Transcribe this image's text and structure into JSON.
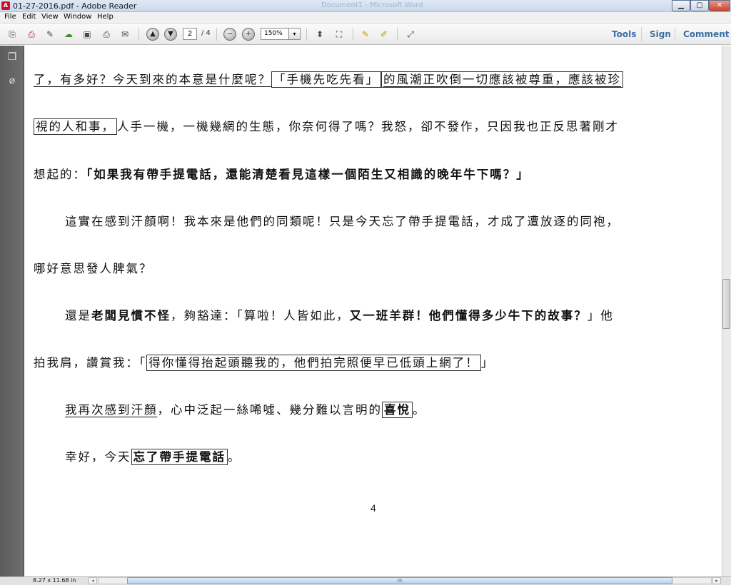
{
  "window": {
    "title": "01-27-2016.pdf - Adobe Reader",
    "background_title": "Document1 - Microsoft Word",
    "app_icon_glyph": "A",
    "minimize_glyph": "▁",
    "maximize_glyph": "▢",
    "close_glyph": "✕"
  },
  "menu": [
    "File",
    "Edit",
    "View",
    "Window",
    "Help"
  ],
  "toolbar": {
    "current_page": "2",
    "page_total": "/ 4",
    "zoom": "150%",
    "zoom_dropdown_glyph": "▾",
    "right_links": [
      "Tools",
      "Sign",
      "Comment"
    ],
    "icon_glyphs": {
      "create": "⎘",
      "pdf": "⎙",
      "edit": "✎",
      "upload": "☁",
      "save": "▣",
      "print": "⎙",
      "email": "✉",
      "prev_page": "▲",
      "next_page": "▼",
      "zoom_out": "−",
      "zoom_in": "+",
      "fit_page": "⬍",
      "fit_width": "⛶",
      "comment": "✎",
      "highlight": "✐",
      "fullscreen": "⤢"
    }
  },
  "nav_pane": {
    "icons": [
      "page-thumbnails-icon",
      "attachments-icon"
    ],
    "icon_glyphs": [
      "❐",
      "⌀"
    ]
  },
  "document": {
    "lines": [
      {
        "segments": [
          {
            "text": "了，有多好？今天到來的本意是什麼呢？",
            "style": "ul"
          },
          {
            "text": "「手機先吃先看」",
            "style": "box"
          },
          {
            "text": "的風潮正吹倒一切應該被尊重，應該被珍",
            "style": "ul-box"
          }
        ]
      },
      {
        "segments": [
          {
            "text": "視的人和事，",
            "style": "box"
          },
          {
            "text": "人手一機，一機幾網的生態，你奈何得了嗎？我怒，卻不發作，只因我也正反思著剛才",
            "style": ""
          }
        ]
      },
      {
        "segments": [
          {
            "text": "想起的：",
            "style": ""
          },
          {
            "text": "「如果我有帶手提電話，還能清楚看見這樣一個陌生又相識的晚年牛下嗎？」",
            "style": "bold"
          }
        ]
      },
      {
        "segments": [
          {
            "text": "這實在感到汗顏啊！我本來是他們的同類呢！只是今天忘了帶手提電話，才成了遭放逐的同袍，",
            "style": ""
          }
        ]
      },
      {
        "segments": [
          {
            "text": "哪好意思發人脾氣？",
            "style": ""
          }
        ]
      },
      {
        "segments": [
          {
            "text": "還是",
            "style": ""
          },
          {
            "text": "老闆見慣不怪",
            "style": "bold"
          },
          {
            "text": "，夠豁達：「算啦！人皆如此，",
            "style": ""
          },
          {
            "text": "又一班羊群！他們懂得多少牛下的故事？",
            "style": "bold"
          },
          {
            "text": "」他",
            "style": ""
          }
        ]
      },
      {
        "segments": [
          {
            "text": "拍我肩，讚賞我：「",
            "style": ""
          },
          {
            "text": "得你懂得抬起頭聽我的，他們拍完照便早已低頭上網了！",
            "style": "box"
          },
          {
            "text": "」",
            "style": ""
          }
        ]
      },
      {
        "segments": [
          {
            "text": "我再次感到汗顏",
            "style": "ul"
          },
          {
            "text": "，心中泛起一絲唏噓、幾分難以言明的",
            "style": ""
          },
          {
            "text": "喜悅",
            "style": "bold-box"
          },
          {
            "text": "。",
            "style": ""
          }
        ]
      },
      {
        "segments": [
          {
            "text": "幸好，今天",
            "style": ""
          },
          {
            "text": "忘了帶手提電話",
            "style": "bold-box"
          },
          {
            "text": "。",
            "style": ""
          }
        ]
      }
    ],
    "page_number": "4"
  },
  "status": {
    "page_size": "8.27 x 11.68 in",
    "left_arrow": "◂",
    "right_arrow": "▸",
    "thumb_grip": "III"
  }
}
